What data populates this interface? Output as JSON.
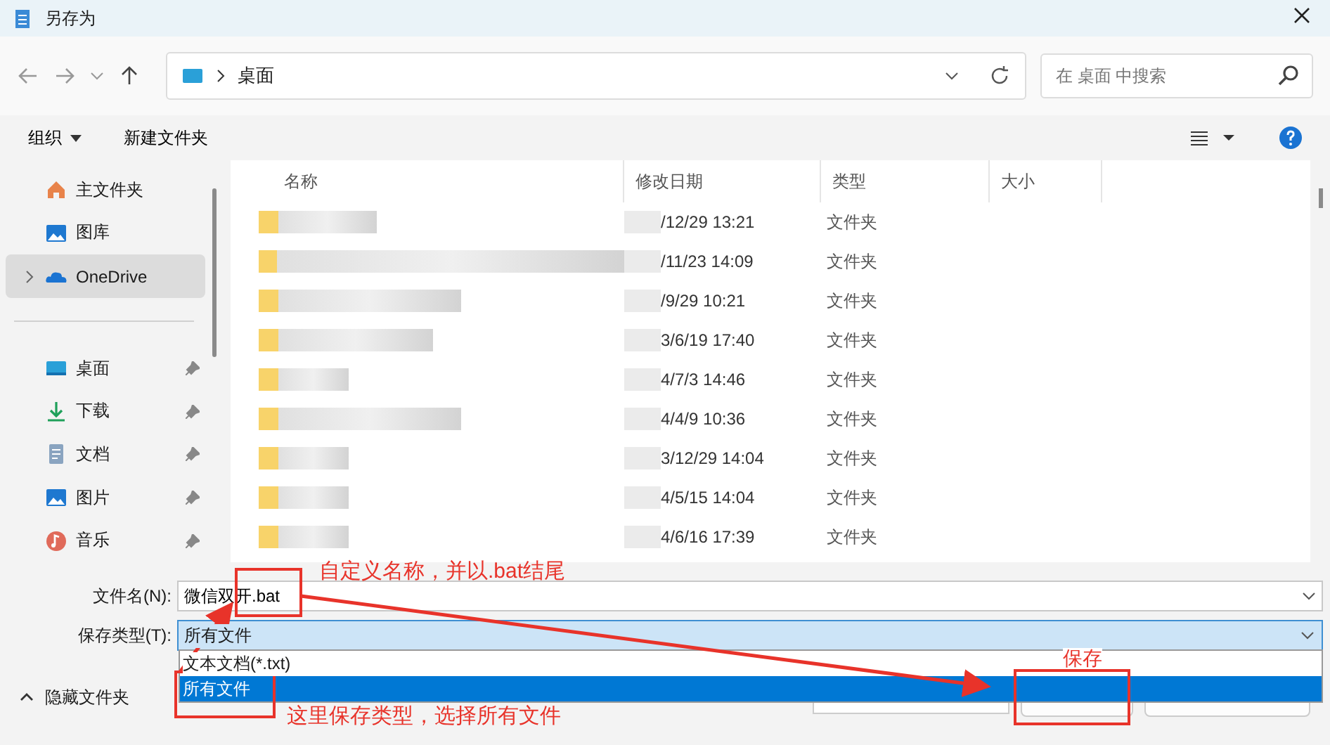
{
  "window": {
    "title": "另存为"
  },
  "nav": {
    "path": "桌面",
    "search_placeholder": "在 桌面 中搜索"
  },
  "toolbar": {
    "organize": "组织",
    "new_folder": "新建文件夹"
  },
  "sidebar": {
    "items": [
      {
        "label": "主文件夹",
        "kind": "home",
        "pinned": false,
        "selected": false,
        "expandable": false
      },
      {
        "label": "图库",
        "kind": "gallery",
        "pinned": false,
        "selected": false,
        "expandable": false
      },
      {
        "label": "OneDrive",
        "kind": "cloud",
        "pinned": false,
        "selected": true,
        "expandable": true
      },
      {
        "label": "桌面",
        "kind": "desktop",
        "pinned": true,
        "selected": false,
        "expandable": false
      },
      {
        "label": "下载",
        "kind": "download",
        "pinned": true,
        "selected": false,
        "expandable": false
      },
      {
        "label": "文档",
        "kind": "document",
        "pinned": true,
        "selected": false,
        "expandable": false
      },
      {
        "label": "图片",
        "kind": "gallery",
        "pinned": true,
        "selected": false,
        "expandable": false
      },
      {
        "label": "音乐",
        "kind": "music",
        "pinned": true,
        "selected": false,
        "expandable": false
      }
    ]
  },
  "table": {
    "columns": [
      "名称",
      "修改日期",
      "类型",
      "大小"
    ],
    "rows": [
      {
        "modified": "/12/29 13:21",
        "type": "文件夹"
      },
      {
        "modified": "/11/23 14:09",
        "type": "文件夹"
      },
      {
        "modified": "/9/29 10:21",
        "type": "文件夹"
      },
      {
        "modified": "3/6/19 17:40",
        "type": "文件夹"
      },
      {
        "modified": "4/7/3 14:46",
        "type": "文件夹"
      },
      {
        "modified": "4/4/9 10:36",
        "type": "文件夹"
      },
      {
        "modified": "3/12/29 14:04",
        "type": "文件夹"
      },
      {
        "modified": "4/5/15 14:04",
        "type": "文件夹"
      },
      {
        "modified": "4/6/16 17:39",
        "type": "文件夹"
      }
    ]
  },
  "file_name": {
    "label": "文件名(N):",
    "value": "微信双开.bat"
  },
  "save_type": {
    "label": "保存类型(T):",
    "value": "所有文件",
    "options": [
      {
        "label": "文本文档(*.txt)",
        "selected": false
      },
      {
        "label": "所有文件",
        "selected": true
      }
    ]
  },
  "hide_folders": "隐藏文件夹",
  "annotations": [
    "自定义名称，并以.bat结尾",
    "保存",
    "这里保存类型，选择所有文件"
  ]
}
